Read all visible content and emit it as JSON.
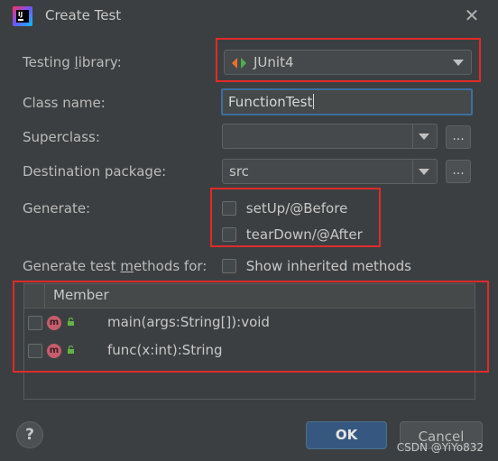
{
  "window": {
    "title": "Create Test"
  },
  "form": {
    "testing_library": {
      "label_pre": "Testing ",
      "label_ul": "l",
      "label_post": "ibrary:",
      "value": "JUnit4"
    },
    "class_name": {
      "label": "Class name:",
      "value": "FunctionTest"
    },
    "superclass": {
      "label": "Superclass:",
      "value": "",
      "browse_label": "..."
    },
    "destination_package": {
      "label": "Destination package:",
      "value": "src",
      "browse_label": "..."
    },
    "generate": {
      "label": "Generate:",
      "options": [
        {
          "label": "setUp/@Before",
          "checked": false
        },
        {
          "label": "tearDown/@After",
          "checked": false
        }
      ]
    },
    "methods_for": {
      "label_pre": "Generate test ",
      "label_ul": "m",
      "label_post": "ethods for:",
      "show_inherited_label": "Show inherited methods",
      "show_inherited_checked": false
    }
  },
  "methods_table": {
    "column_header": "Member",
    "rows": [
      {
        "signature": "main(args:String[]):void",
        "checked": false,
        "icon": "method-icon"
      },
      {
        "signature": "func(x:int):String",
        "checked": false,
        "icon": "method-icon"
      }
    ]
  },
  "buttons": {
    "help": "?",
    "ok": "OK",
    "cancel": "Cancel"
  },
  "watermark": "CSDN @YiYo832",
  "colors": {
    "highlight_box": "#e02a2a",
    "ok_button": "#365880",
    "background": "#3c3f41"
  }
}
